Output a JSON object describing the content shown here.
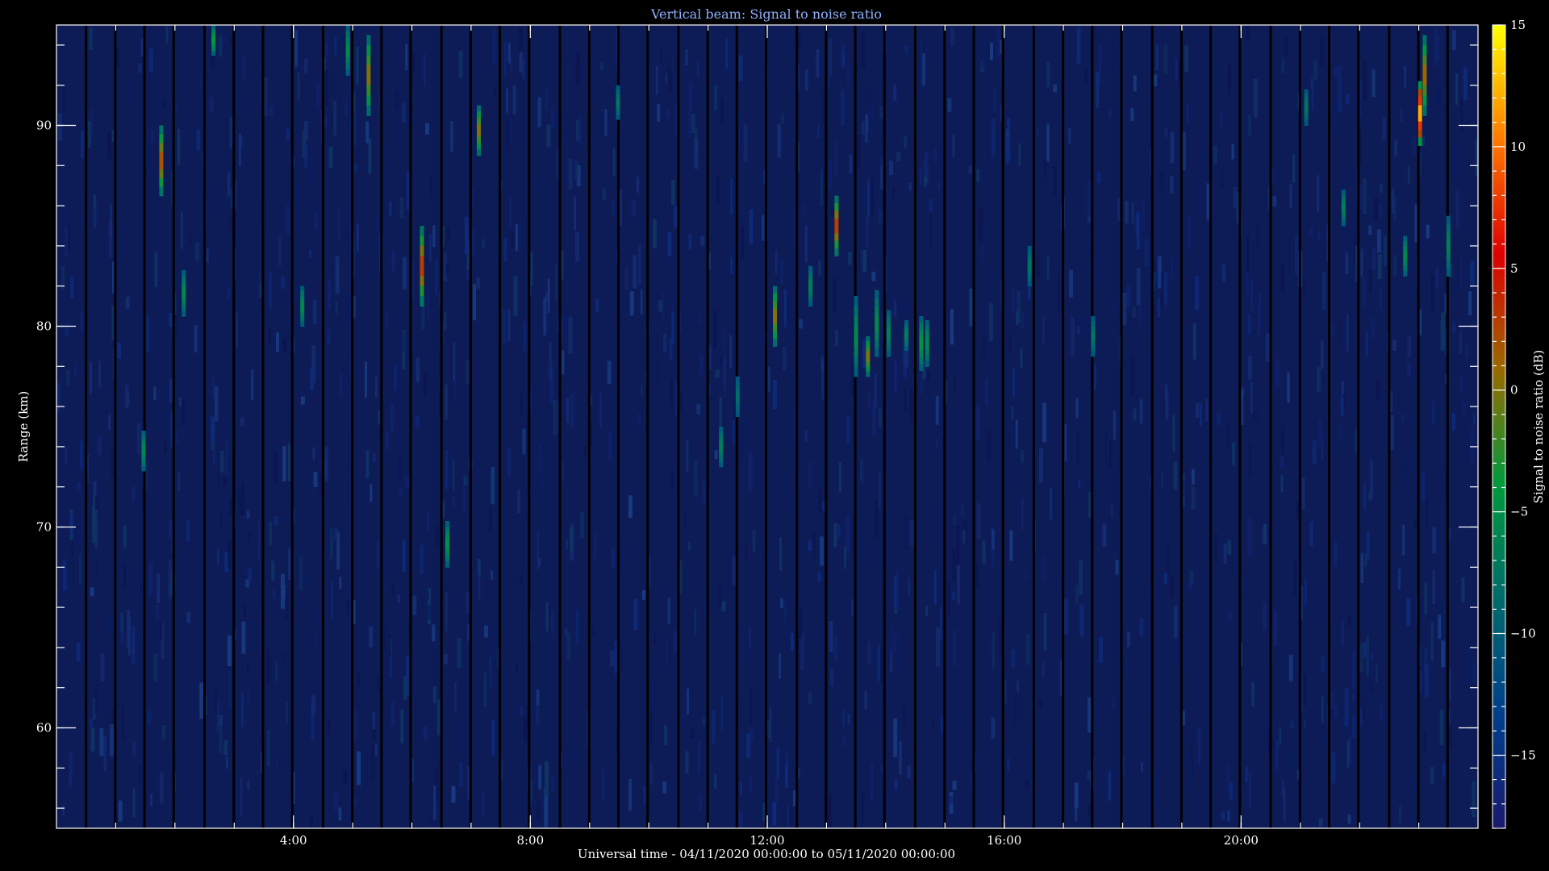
{
  "chart_data": {
    "type": "heatmap",
    "title": "Vertical beam: Signal to noise ratio",
    "xlabel": "Universal time - 04/11/2020 00:00:00 to 05/11/2020 00:00:00",
    "ylabel": "Range (km)",
    "xlim_hours": [
      0,
      24
    ],
    "ylim_km": [
      55,
      95
    ],
    "x_ticks": [
      {
        "value": 4,
        "label": "4:00"
      },
      {
        "value": 8,
        "label": "8:00"
      },
      {
        "value": 12,
        "label": "12:00"
      },
      {
        "value": 16,
        "label": "16:00"
      },
      {
        "value": 20,
        "label": "20:00"
      }
    ],
    "y_ticks": [
      {
        "value": 60,
        "label": "60"
      },
      {
        "value": 70,
        "label": "70"
      },
      {
        "value": 80,
        "label": "80"
      },
      {
        "value": 90,
        "label": "90"
      }
    ],
    "colorbar": {
      "label": "Signal to noise ratio (dB)",
      "range": [
        -18,
        15
      ],
      "ticks": [
        {
          "value": -15,
          "label": "−15"
        },
        {
          "value": -10,
          "label": "−10"
        },
        {
          "value": -5,
          "label": "−5"
        },
        {
          "value": 0,
          "label": "0"
        },
        {
          "value": 5,
          "label": "5"
        },
        {
          "value": 10,
          "label": "10"
        },
        {
          "value": 15,
          "label": "15"
        }
      ],
      "colors": [
        "#1a1a6e",
        "#003f8c",
        "#006b6b",
        "#009a3c",
        "#9a6a00",
        "#dd0000",
        "#ff7a00",
        "#ffff00"
      ]
    },
    "background_snr_db": -15,
    "echoes": [
      {
        "t": 1.47,
        "r1": 72.8,
        "r2": 74.8,
        "snr": -5
      },
      {
        "t": 1.77,
        "r1": 86.5,
        "r2": 90,
        "snr": 3
      },
      {
        "t": 2.15,
        "r1": 80.5,
        "r2": 82.8,
        "snr": -5
      },
      {
        "t": 2.65,
        "r1": 93.5,
        "r2": 95,
        "snr": -3
      },
      {
        "t": 4.15,
        "r1": 80,
        "r2": 82,
        "snr": -5
      },
      {
        "t": 4.92,
        "r1": 92.5,
        "r2": 95,
        "snr": -5
      },
      {
        "t": 5.27,
        "r1": 90.5,
        "r2": 94.5,
        "snr": 1
      },
      {
        "t": 6.17,
        "r1": 81,
        "r2": 85,
        "snr": 4
      },
      {
        "t": 6.6,
        "r1": 68,
        "r2": 70.3,
        "snr": -4
      },
      {
        "t": 7.13,
        "r1": 88.5,
        "r2": 91,
        "snr": 1
      },
      {
        "t": 9.48,
        "r1": 90.3,
        "r2": 92,
        "snr": -7
      },
      {
        "t": 11.22,
        "r1": 73,
        "r2": 75,
        "snr": -6
      },
      {
        "t": 11.5,
        "r1": 75.5,
        "r2": 77.5,
        "snr": -8
      },
      {
        "t": 12.13,
        "r1": 79,
        "r2": 82,
        "snr": 1
      },
      {
        "t": 12.73,
        "r1": 81,
        "r2": 83,
        "snr": -6
      },
      {
        "t": 13.17,
        "r1": 83.5,
        "r2": 86.5,
        "snr": 4
      },
      {
        "t": 13.5,
        "r1": 77.5,
        "r2": 81.5,
        "snr": -5
      },
      {
        "t": 13.7,
        "r1": 77.5,
        "r2": 79.5,
        "snr": 1
      },
      {
        "t": 13.85,
        "r1": 78.5,
        "r2": 81.8,
        "snr": -5
      },
      {
        "t": 14.05,
        "r1": 78.5,
        "r2": 80.8,
        "snr": -6
      },
      {
        "t": 14.35,
        "r1": 78.8,
        "r2": 80.3,
        "snr": -6
      },
      {
        "t": 14.6,
        "r1": 77.8,
        "r2": 80.5,
        "snr": -4
      },
      {
        "t": 14.7,
        "r1": 78,
        "r2": 80.3,
        "snr": -5
      },
      {
        "t": 16.43,
        "r1": 82,
        "r2": 84,
        "snr": -7
      },
      {
        "t": 17.5,
        "r1": 78.5,
        "r2": 80.5,
        "snr": -7
      },
      {
        "t": 21.1,
        "r1": 90,
        "r2": 91.8,
        "snr": -7
      },
      {
        "t": 21.73,
        "r1": 85,
        "r2": 86.8,
        "snr": -6
      },
      {
        "t": 22.77,
        "r1": 82.5,
        "r2": 84.5,
        "snr": -5
      },
      {
        "t": 23.02,
        "r1": 89,
        "r2": 92.2,
        "snr": 14
      },
      {
        "t": 23.1,
        "r1": 90.5,
        "r2": 94.5,
        "snr": 2
      },
      {
        "t": 23.5,
        "r1": 82.5,
        "r2": 85.5,
        "snr": -6
      }
    ]
  }
}
